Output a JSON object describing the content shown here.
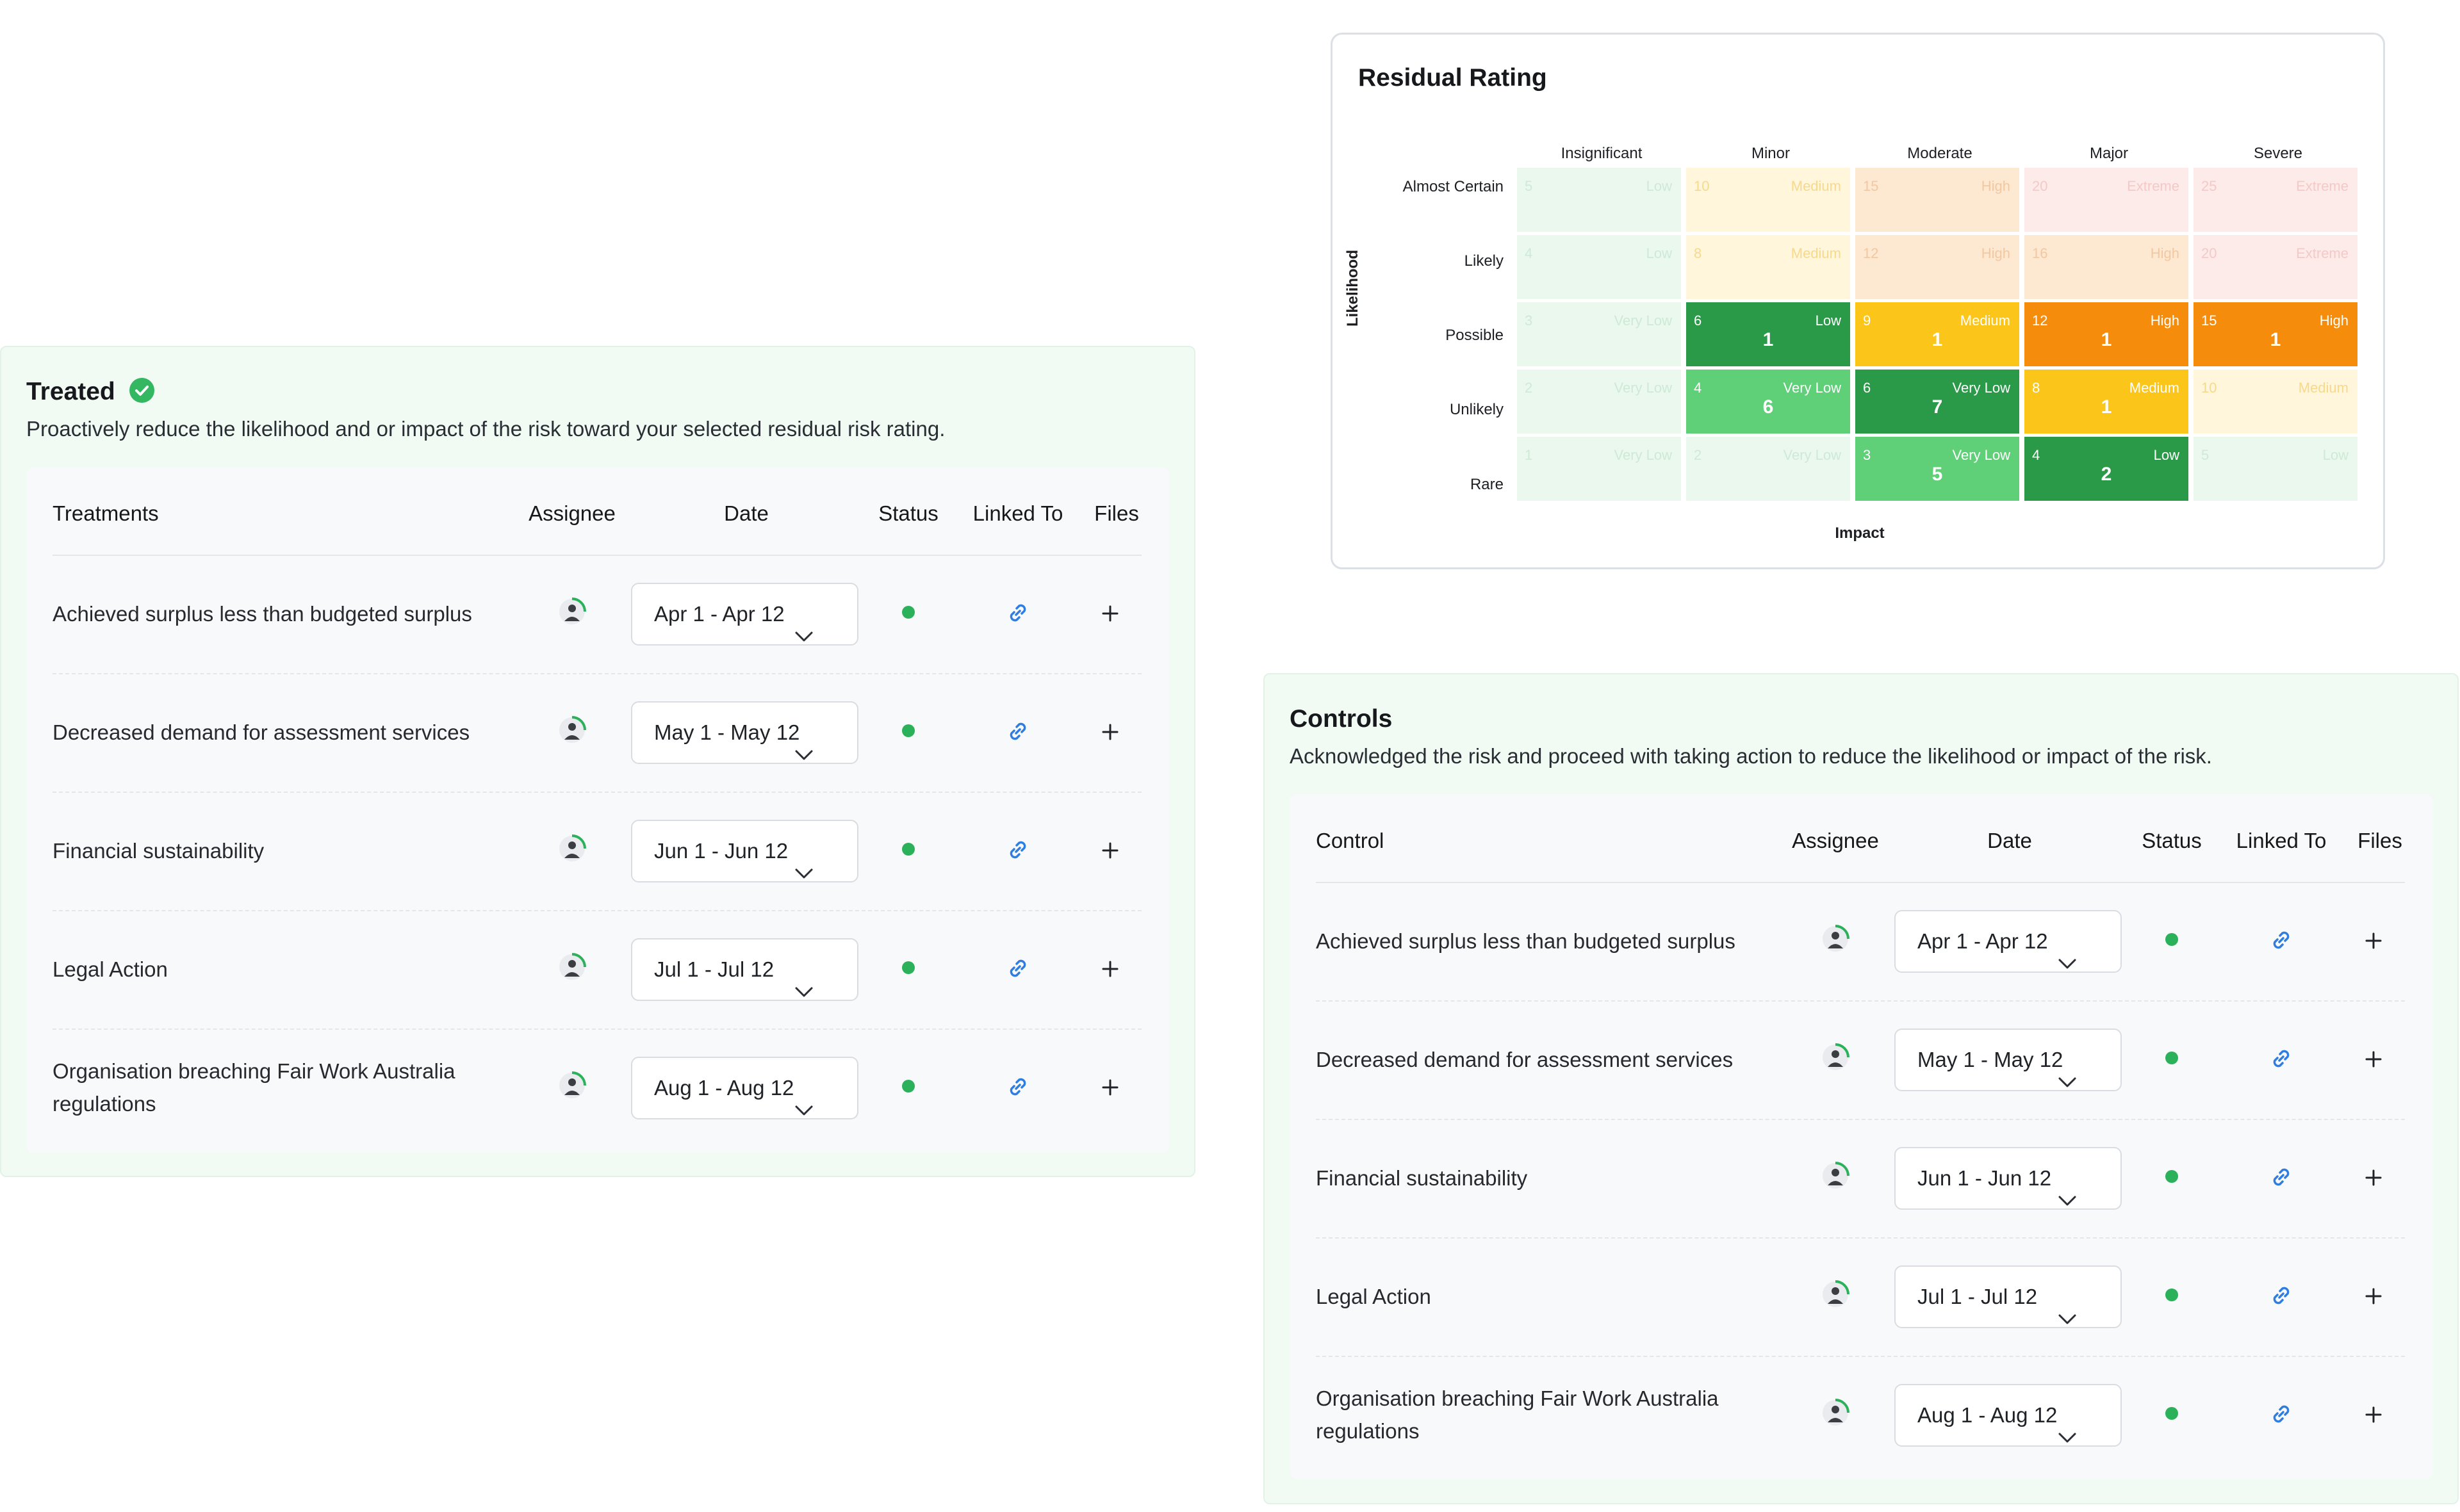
{
  "treated": {
    "title": "Treated",
    "description": "Proactively reduce the likelihood and or impact of the risk toward your selected residual risk rating.",
    "headers": {
      "name": "Treatments",
      "assignee": "Assignee",
      "date": "Date",
      "status": "Status",
      "linked": "Linked To",
      "files": "Files"
    },
    "rows": [
      {
        "name": "Achieved surplus less than budgeted surplus",
        "date": "Apr 1 - Apr 12"
      },
      {
        "name": "Decreased demand for assessment services",
        "date": "May 1 - May 12"
      },
      {
        "name": "Financial sustainability",
        "date": "Jun 1 - Jun 12"
      },
      {
        "name": "Legal Action",
        "date": "Jul 1 - Jul 12"
      },
      {
        "name": "Organisation breaching Fair Work Australia regulations",
        "date": "Aug 1 - Aug 12"
      }
    ]
  },
  "controls": {
    "title": "Controls",
    "description": "Acknowledged the risk and proceed with taking action to reduce the likelihood or impact of the risk.",
    "headers": {
      "name": "Control",
      "assignee": "Assignee",
      "date": "Date",
      "status": "Status",
      "linked": "Linked To",
      "files": "Files"
    },
    "rows": [
      {
        "name": "Achieved surplus less than budgeted surplus",
        "date": "Apr 1 - Apr 12"
      },
      {
        "name": "Decreased demand for assessment services",
        "date": "May 1 - May 12"
      },
      {
        "name": "Financial sustainability",
        "date": "Jun 1 - Jun 12"
      },
      {
        "name": "Legal Action",
        "date": "Jul 1 - Jul 12"
      },
      {
        "name": "Organisation breaching Fair Work Australia regulations",
        "date": "Aug 1 - Aug 12"
      }
    ]
  },
  "matrix": {
    "title": "Residual Rating",
    "x_axis": "Impact",
    "y_axis": "Likelihood",
    "columns": [
      "Insignificant",
      "Minor",
      "Moderate",
      "Major",
      "Severe"
    ],
    "rows": [
      "Almost Certain",
      "Likely",
      "Possible",
      "Unlikely",
      "Rare"
    ],
    "cells": [
      [
        {
          "score": "5",
          "level": "Low",
          "count": ""
        },
        {
          "score": "10",
          "level": "Medium",
          "count": ""
        },
        {
          "score": "15",
          "level": "High",
          "count": ""
        },
        {
          "score": "20",
          "level": "Extreme",
          "count": ""
        },
        {
          "score": "25",
          "level": "Extreme",
          "count": ""
        }
      ],
      [
        {
          "score": "4",
          "level": "Low",
          "count": ""
        },
        {
          "score": "8",
          "level": "Medium",
          "count": ""
        },
        {
          "score": "12",
          "level": "High",
          "count": ""
        },
        {
          "score": "16",
          "level": "High",
          "count": ""
        },
        {
          "score": "20",
          "level": "Extreme",
          "count": ""
        }
      ],
      [
        {
          "score": "3",
          "level": "Very Low",
          "count": ""
        },
        {
          "score": "6",
          "level": "Low",
          "count": "1"
        },
        {
          "score": "9",
          "level": "Medium",
          "count": "1"
        },
        {
          "score": "12",
          "level": "High",
          "count": "1"
        },
        {
          "score": "15",
          "level": "High",
          "count": "1"
        }
      ],
      [
        {
          "score": "2",
          "level": "Very Low",
          "count": ""
        },
        {
          "score": "4",
          "level": "Very Low",
          "count": "6"
        },
        {
          "score": "6",
          "level": "Very Low",
          "count": "7"
        },
        {
          "score": "8",
          "level": "Medium",
          "count": "1"
        },
        {
          "score": "10",
          "level": "Medium",
          "count": ""
        }
      ],
      [
        {
          "score": "1",
          "level": "Very Low",
          "count": ""
        },
        {
          "score": "2",
          "level": "Very Low",
          "count": ""
        },
        {
          "score": "3",
          "level": "Very Low",
          "count": "5"
        },
        {
          "score": "4",
          "level": "Low",
          "count": "2"
        },
        {
          "score": "5",
          "level": "Low",
          "count": ""
        }
      ]
    ],
    "colors": {
      "faded_green": "#eaf8ee",
      "faded_yellow": "#fff6dc",
      "faded_orange": "#fde8d2",
      "faded_red": "#fdebea",
      "dark_green": "#2a9a48",
      "light_green": "#5fcf78",
      "yellow": "#fbc51a",
      "orange": "#f68c0c"
    }
  }
}
